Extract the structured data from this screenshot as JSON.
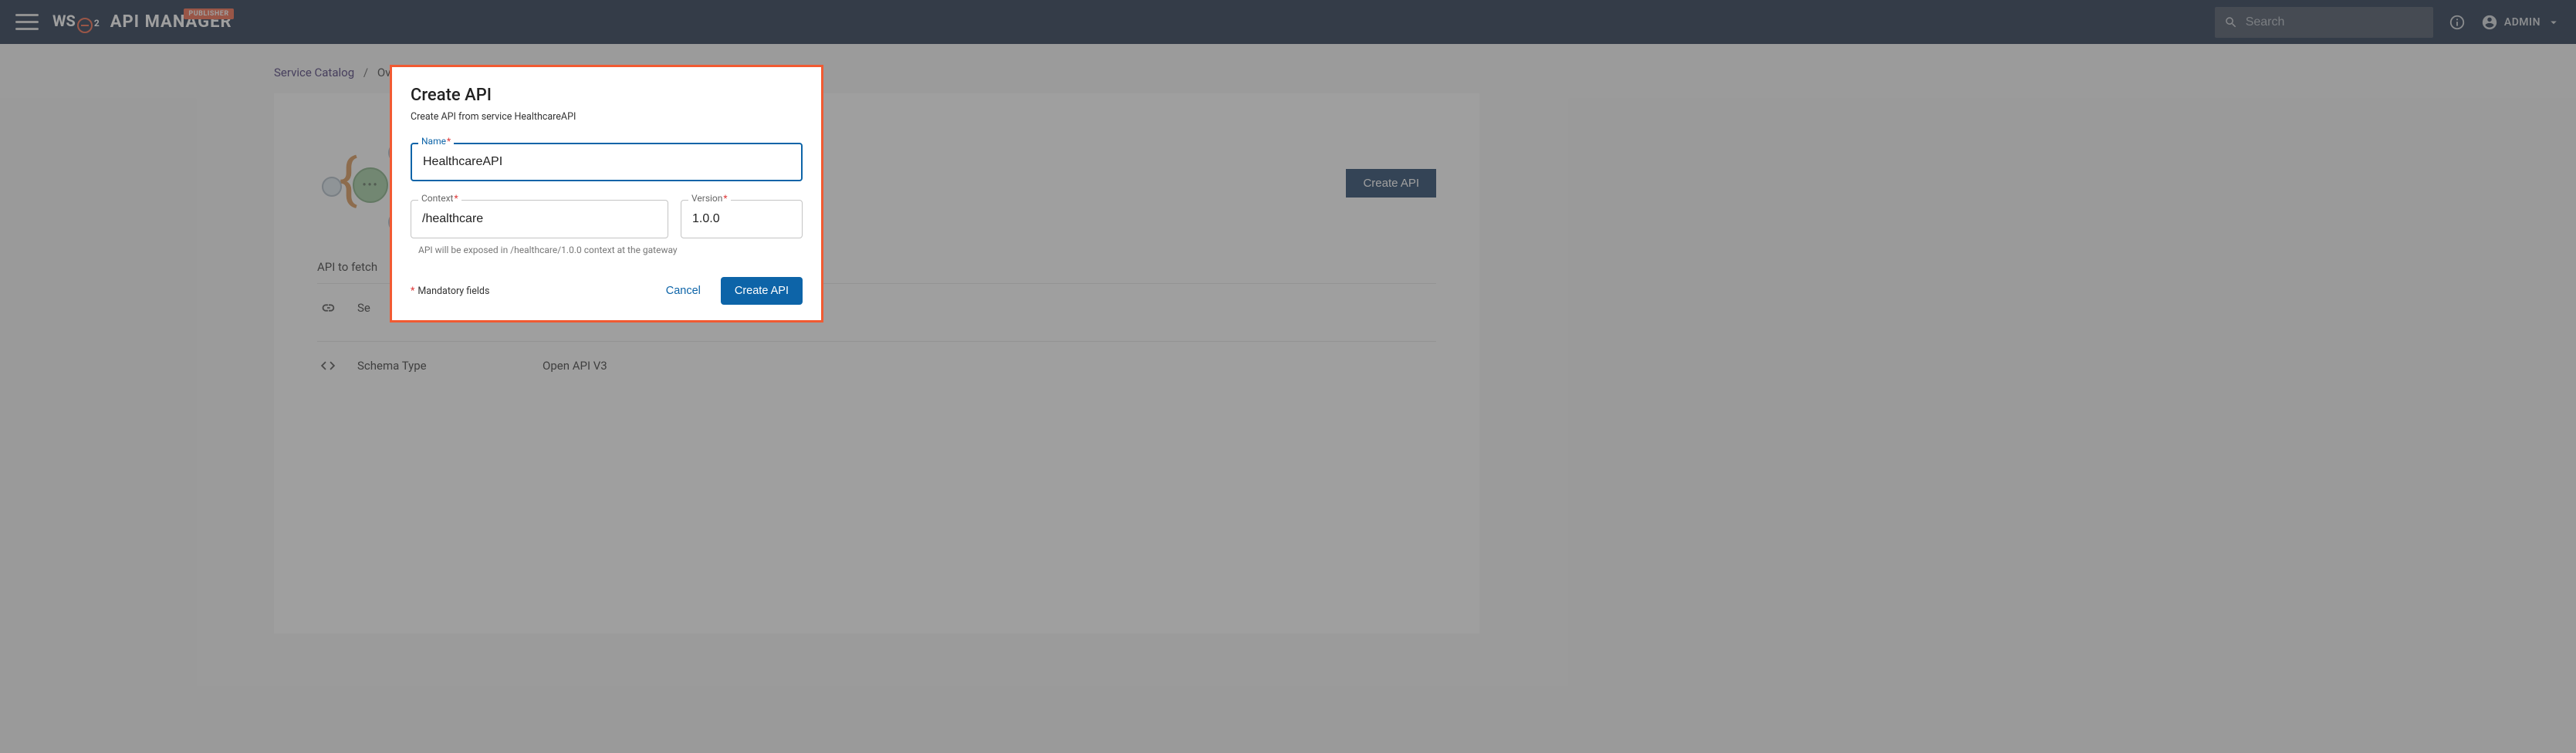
{
  "header": {
    "publisher_tag": "PUBLISHER",
    "app_title": "API MANAGER",
    "search_placeholder": "Search",
    "user_name": "ADMIN"
  },
  "breadcrumb": {
    "root": "Service Catalog",
    "current": "Overview"
  },
  "page": {
    "create_button": "Create API",
    "description_prefix": "API to fetch",
    "rows": [
      {
        "icon": "link-icon",
        "label_prefix": "Se",
        "value": ""
      },
      {
        "icon": "code-icon",
        "label": "Schema Type",
        "value": "Open API V3"
      }
    ]
  },
  "modal": {
    "title": "Create API",
    "subtitle": "Create API from service HealthcareAPI",
    "fields": {
      "name": {
        "label": "Name",
        "value": "HealthcareAPI"
      },
      "context": {
        "label": "Context",
        "value": "/healthcare"
      },
      "version": {
        "label": "Version",
        "value": "1.0.0"
      }
    },
    "context_helper": "API will be exposed in /healthcare/1.0.0 context at the gateway",
    "mandatory_text": "Mandatory fields",
    "cancel": "Cancel",
    "submit": "Create API"
  }
}
